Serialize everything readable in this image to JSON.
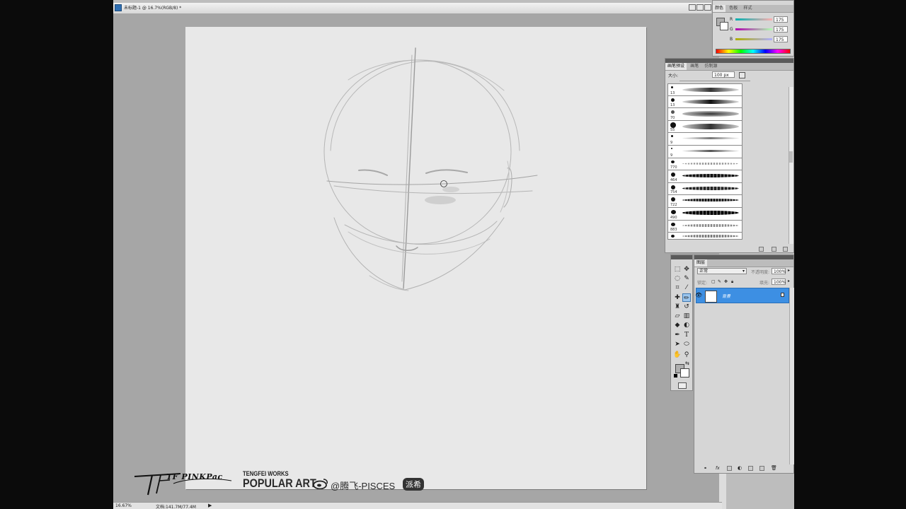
{
  "document": {
    "title": "未标题-1 @ 16.7%(RGB/8) *",
    "zoom": "16.67%",
    "doc_info": "文档:141.7M/77.4M"
  },
  "color_panel": {
    "tabs": [
      "颜色",
      "色板",
      "样式"
    ],
    "channels": [
      {
        "label": "R",
        "value": "175"
      },
      {
        "label": "G",
        "value": "175"
      },
      {
        "label": "B",
        "value": "175"
      }
    ],
    "foreground": "#afafaf",
    "background": "#ffffff"
  },
  "brush_panel": {
    "tabs": [
      "画笔预设",
      "画笔",
      "仿制源"
    ],
    "size_label": "大小:",
    "size_value": "100 px",
    "brushes": [
      {
        "size": "13"
      },
      {
        "size": "13"
      },
      {
        "size": "70"
      },
      {
        "size": "55"
      },
      {
        "size": "9"
      },
      {
        "size": "9"
      },
      {
        "size": "770"
      },
      {
        "size": "464"
      },
      {
        "size": "754"
      },
      {
        "size": "722"
      },
      {
        "size": "490"
      },
      {
        "size": "883"
      },
      {
        "size": ""
      }
    ]
  },
  "layers_panel": {
    "tab": "图层",
    "blend_mode": "正常",
    "opacity_label": "不透明度:",
    "opacity_value": "100%",
    "lock_label": "锁定:",
    "fill_label": "填充:",
    "fill_value": "100%",
    "layers": [
      {
        "name": "背景",
        "selected": true
      }
    ]
  },
  "watermark": {
    "signature": "TF PINKPac",
    "brand_top": "TENGFEI WORKS",
    "brand_main": "POPULAR ART",
    "weibo_handle": "@腾飞-PISCES",
    "badge": "派希"
  },
  "colors": {
    "accent_selection": "#3d8fe3",
    "canvas": "#e8e8e8",
    "workspace": "#a6a6a6"
  }
}
